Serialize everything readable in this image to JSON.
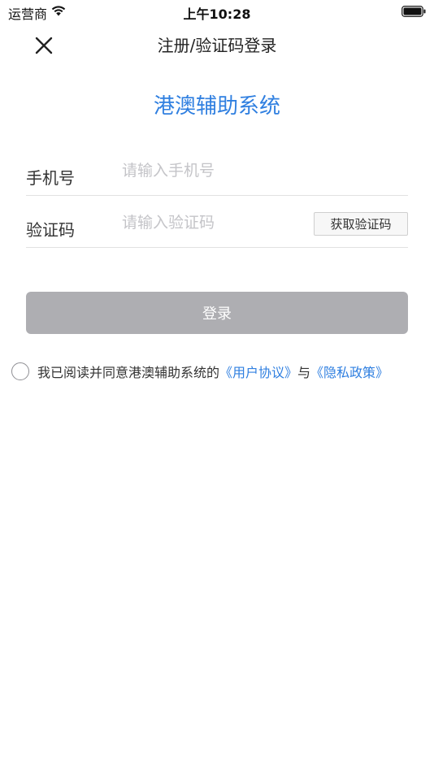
{
  "status_bar": {
    "carrier": "运营商",
    "time": "上午10:28",
    "wifi_icon": "wifi-icon",
    "battery_icon": "battery-icon"
  },
  "nav": {
    "close_icon": "close-icon",
    "title": "注册/验证码登录"
  },
  "app_title": "港澳辅助系统",
  "form": {
    "phone": {
      "label": "手机号",
      "placeholder": "请输入手机号",
      "value": ""
    },
    "code": {
      "label": "验证码",
      "placeholder": "请输入验证码",
      "value": "",
      "get_code_label": "获取验证码"
    }
  },
  "login_button": {
    "label": "登录",
    "color": "#aeaeb2"
  },
  "agreement": {
    "checked": false,
    "prefix": "我已阅读并同意港澳辅助系统的",
    "user_agreement": "《用户协议》",
    "and": "与",
    "privacy_policy": "《隐私政策》"
  },
  "colors": {
    "accent": "#2f7fe0",
    "disabled_button": "#aeaeb2",
    "divider": "#e2e2e2"
  }
}
